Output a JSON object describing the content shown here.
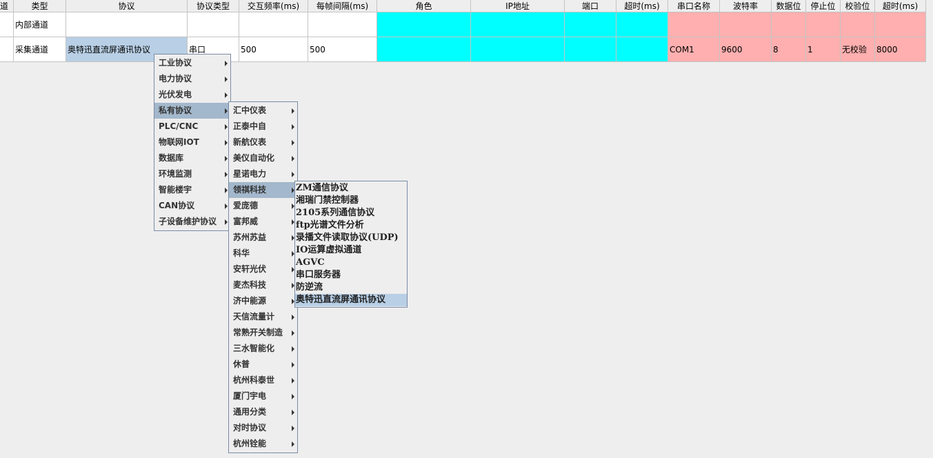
{
  "table": {
    "headers": [
      "道",
      "类型",
      "协议",
      "协议类型",
      "交互频率(ms)",
      "每帧间隔(ms)",
      "角色",
      "IP地址",
      "端口",
      "超时(ms)",
      "串口名称",
      "波特率",
      "数据位",
      "停止位",
      "校验位",
      "超时(ms)"
    ],
    "rows": [
      [
        "",
        "内部通道",
        "",
        "",
        "",
        "",
        "",
        "",
        "",
        "",
        "",
        "",
        "",
        "",
        "",
        ""
      ],
      [
        "",
        "采集通道",
        "奥特迅直流屏通讯协议",
        "串口",
        "500",
        "500",
        "",
        "",
        "",
        "",
        "COM1",
        "9600",
        "8",
        "1",
        "无校验",
        "8000"
      ]
    ]
  },
  "menu_level1": {
    "items": [
      {
        "label": "工业协议"
      },
      {
        "label": "电力协议"
      },
      {
        "label": "光伏发电"
      },
      {
        "label": "私有协议"
      },
      {
        "label": "PLC/CNC"
      },
      {
        "label": "物联网IOT"
      },
      {
        "label": "数据库"
      },
      {
        "label": "环境监测"
      },
      {
        "label": "智能楼宇"
      },
      {
        "label": "CAN协议"
      },
      {
        "label": "子设备维护协议"
      }
    ],
    "highlighted": "私有协议"
  },
  "menu_level2": {
    "items": [
      {
        "label": "汇中仪表"
      },
      {
        "label": "正泰中自"
      },
      {
        "label": "新航仪表"
      },
      {
        "label": "美仪自动化"
      },
      {
        "label": "星诺电力"
      },
      {
        "label": "领祺科技"
      },
      {
        "label": "爱庞德"
      },
      {
        "label": "富邦威"
      },
      {
        "label": "苏州苏益"
      },
      {
        "label": "科华"
      },
      {
        "label": "安轩光伏"
      },
      {
        "label": "麦杰科技"
      },
      {
        "label": "济中能源"
      },
      {
        "label": "天信流量计"
      },
      {
        "label": "常熟开关制造"
      },
      {
        "label": "三水智能化"
      },
      {
        "label": "休普"
      },
      {
        "label": "杭州科泰世"
      },
      {
        "label": "厦门宇电"
      },
      {
        "label": "通用分类"
      },
      {
        "label": "对时协议"
      },
      {
        "label": "杭州铨能"
      }
    ],
    "highlighted": "领祺科技"
  },
  "menu_level3": {
    "items": [
      {
        "label": "ZM通信协议"
      },
      {
        "label": "湘瑞门禁控制器"
      },
      {
        "label": "2105系列通信协议"
      },
      {
        "label": "ftp光谱文件分析"
      },
      {
        "label": "录播文件读取协议(UDP)"
      },
      {
        "label": "IO运算虚拟通道"
      },
      {
        "label": "AGVC"
      },
      {
        "label": "串口服务器"
      },
      {
        "label": "防逆流"
      },
      {
        "label": "奥特迅直流屏通讯协议"
      }
    ],
    "highlighted": "奥特迅直流屏通讯协议"
  },
  "colors": {
    "network_cells": "#00ffff",
    "serial_cells": "#ffafaf",
    "selection": "#b8cfe5",
    "menu_highlight": "#a3b8cc"
  }
}
